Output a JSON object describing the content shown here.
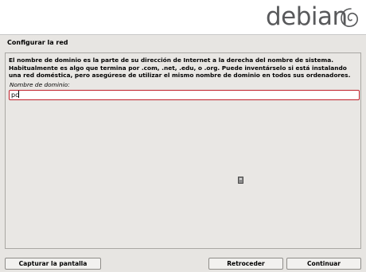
{
  "banner": {
    "logo_text": "debian",
    "logo_icon": "debian-swirl-icon"
  },
  "page": {
    "title": "Configurar la red"
  },
  "panel": {
    "description": "El nombre de dominio es la parte de su dirección de Internet a la derecha del nombre de sistema.\nHabitualmente es algo que termina por .com, .net, .edu, o .org. Puede inventárselo si está instalando\nuna red doméstica, pero asegúrese de utilizar el mismo nombre de dominio en todos sus ordenadores.",
    "field_label": "Nombre de dominio:",
    "field_value": "pc"
  },
  "buttons": {
    "screenshot": "Capturar la pantalla",
    "back": "Retroceder",
    "continue": "Continuar"
  },
  "colors": {
    "background": "#e7e5e2",
    "input_border": "#c0202a",
    "logo_gray": "#58595b",
    "logo_red": "#c70036"
  }
}
